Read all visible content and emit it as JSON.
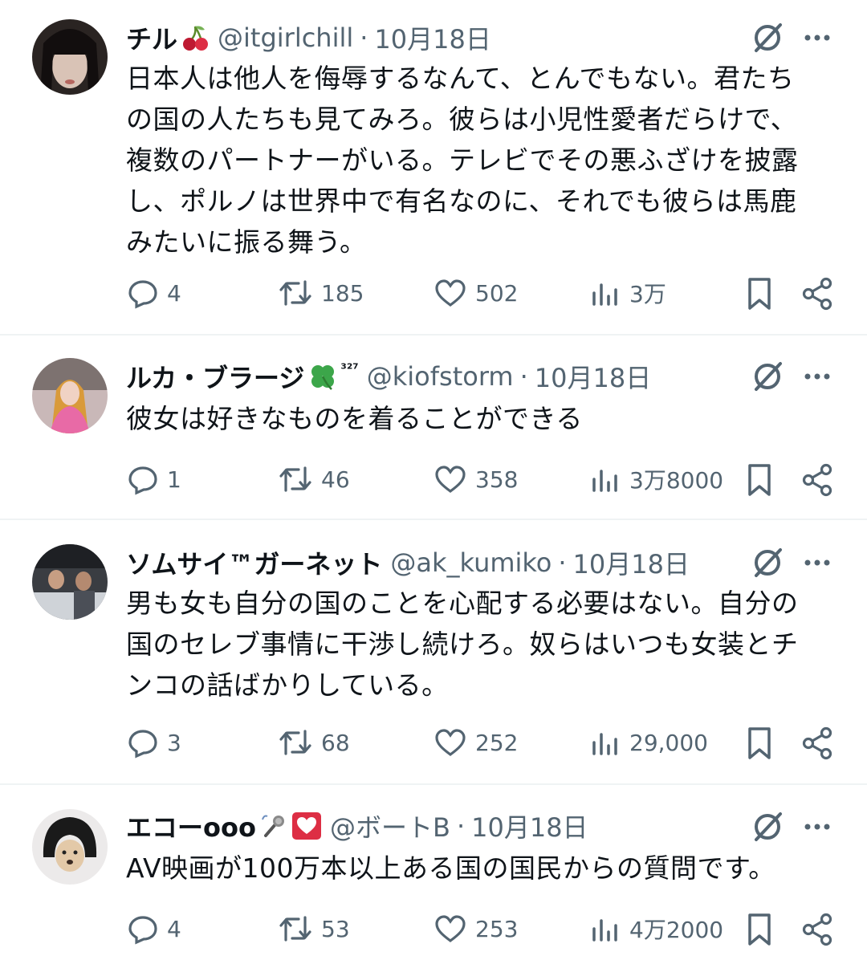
{
  "tweets": [
    {
      "name": "チル",
      "name_emoji": "cherries-emoji",
      "handle": "@itgirlchill",
      "separator": "·",
      "date": "10月18日",
      "text": "日本人は他人を侮辱するなんて、とんでもない。君たち\nの国の人たちも見てみろ。彼らは小児性愛者だらけで、\n複数のパートナーがいる。テレビでその悪ふざけを披露\nし、ポルノは世界中で有名なのに、それでも彼らは馬鹿\nみたいに振る舞う。",
      "replies": "4",
      "retweets": "185",
      "likes": "502",
      "views": "3万"
    },
    {
      "name": "ルカ・ブラージ",
      "name_emoji": "four-leaf-clover-emoji",
      "superscript": "³²⁷",
      "handle": "@kiofstorm",
      "separator": "·",
      "date": "10月18日",
      "text": "彼女は好きなものを着ることができる",
      "replies": "1",
      "retweets": "46",
      "likes": "358",
      "views": "3万8000"
    },
    {
      "name": "ソムサイ™ガーネット",
      "handle": "@ak_kumiko",
      "separator": "·",
      "date": "10月18日",
      "text": "男も女も自分の国のことを心配する必要はない。自分の\n国のセレブ事情に干渉し続けろ。奴らはいつも女装とチ\nンコの話ばかりしている。",
      "replies": "3",
      "retweets": "68",
      "likes": "252",
      "views": "29,000"
    },
    {
      "name": "エコーooo",
      "name_emoji": "microphone-emoji heart-emoji",
      "handle": "@ボートB",
      "separator": "·",
      "date": "10月18日",
      "text": "AV映画が100万本以上ある国の国民からの質問です。",
      "replies": "4",
      "retweets": "53",
      "likes": "253",
      "views": "4万2000"
    }
  ],
  "colors": {
    "text": "#0f1419",
    "secondary": "#536471",
    "divider": "#eff3f4",
    "icon": "#536471"
  },
  "icons": [
    "grok-icon",
    "more-icon",
    "reply-icon",
    "retweet-icon",
    "like-icon",
    "views-icon",
    "bookmark-icon",
    "share-icon"
  ]
}
